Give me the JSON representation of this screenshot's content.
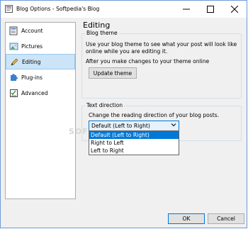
{
  "window": {
    "title": "Blog Options - Softpedia's Blog"
  },
  "sidebar": {
    "items": [
      {
        "label": "Account",
        "icon": "account-icon"
      },
      {
        "label": "Pictures",
        "icon": "pictures-icon"
      },
      {
        "label": "Editing",
        "icon": "editing-icon",
        "selected": true
      },
      {
        "label": "Plug-ins",
        "icon": "plugins-icon"
      },
      {
        "label": "Advanced",
        "icon": "advanced-icon"
      }
    ]
  },
  "panel": {
    "title": "Editing",
    "blog_theme": {
      "label": "Blog theme",
      "description_line1": "Use your blog theme to see what your post will look like",
      "description_line2": "online while you are editing it.",
      "note": "After you make changes to your theme online",
      "button": "Update theme"
    },
    "text_direction": {
      "label": "Text direction",
      "description": "Change the reading direction of your blog posts.",
      "selected": "Default (Left to Right)",
      "options": [
        "Default (Left to Right)",
        "Right to Left",
        "Left to Right"
      ]
    }
  },
  "watermark": "SOFTPEDIA",
  "footer": {
    "ok": "OK",
    "cancel": "Cancel"
  },
  "colors": {
    "selection": "#0078d7",
    "nav_selected": "#cce4f7",
    "window_border": "#6e9ad6"
  }
}
